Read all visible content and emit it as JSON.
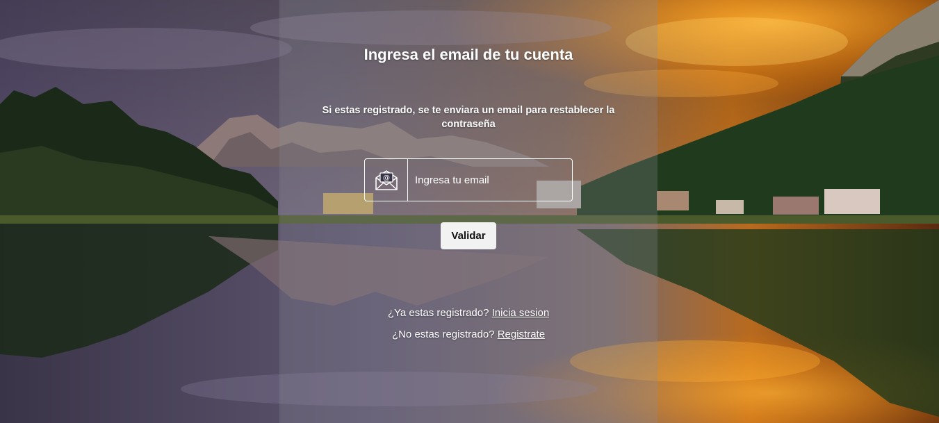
{
  "form": {
    "title": "Ingresa el email de tu cuenta",
    "subtitle": "Si estas registrado, se te enviara un email para restablecer la contraseña",
    "email": {
      "placeholder": "Ingresa tu email",
      "value": "",
      "icon": "envelope-at-icon"
    },
    "submit_label": "Validar"
  },
  "links": {
    "login_prompt": "¿Ya estas registrado?",
    "login_link": "Inicia sesion",
    "register_prompt": "¿No estas registrado?",
    "register_link": "Registrate"
  },
  "colors": {
    "text": "#ffffff",
    "button_bg": "#f2f2f2",
    "button_text": "#111111",
    "panel_overlay": "rgba(140,140,150,0.28)"
  }
}
